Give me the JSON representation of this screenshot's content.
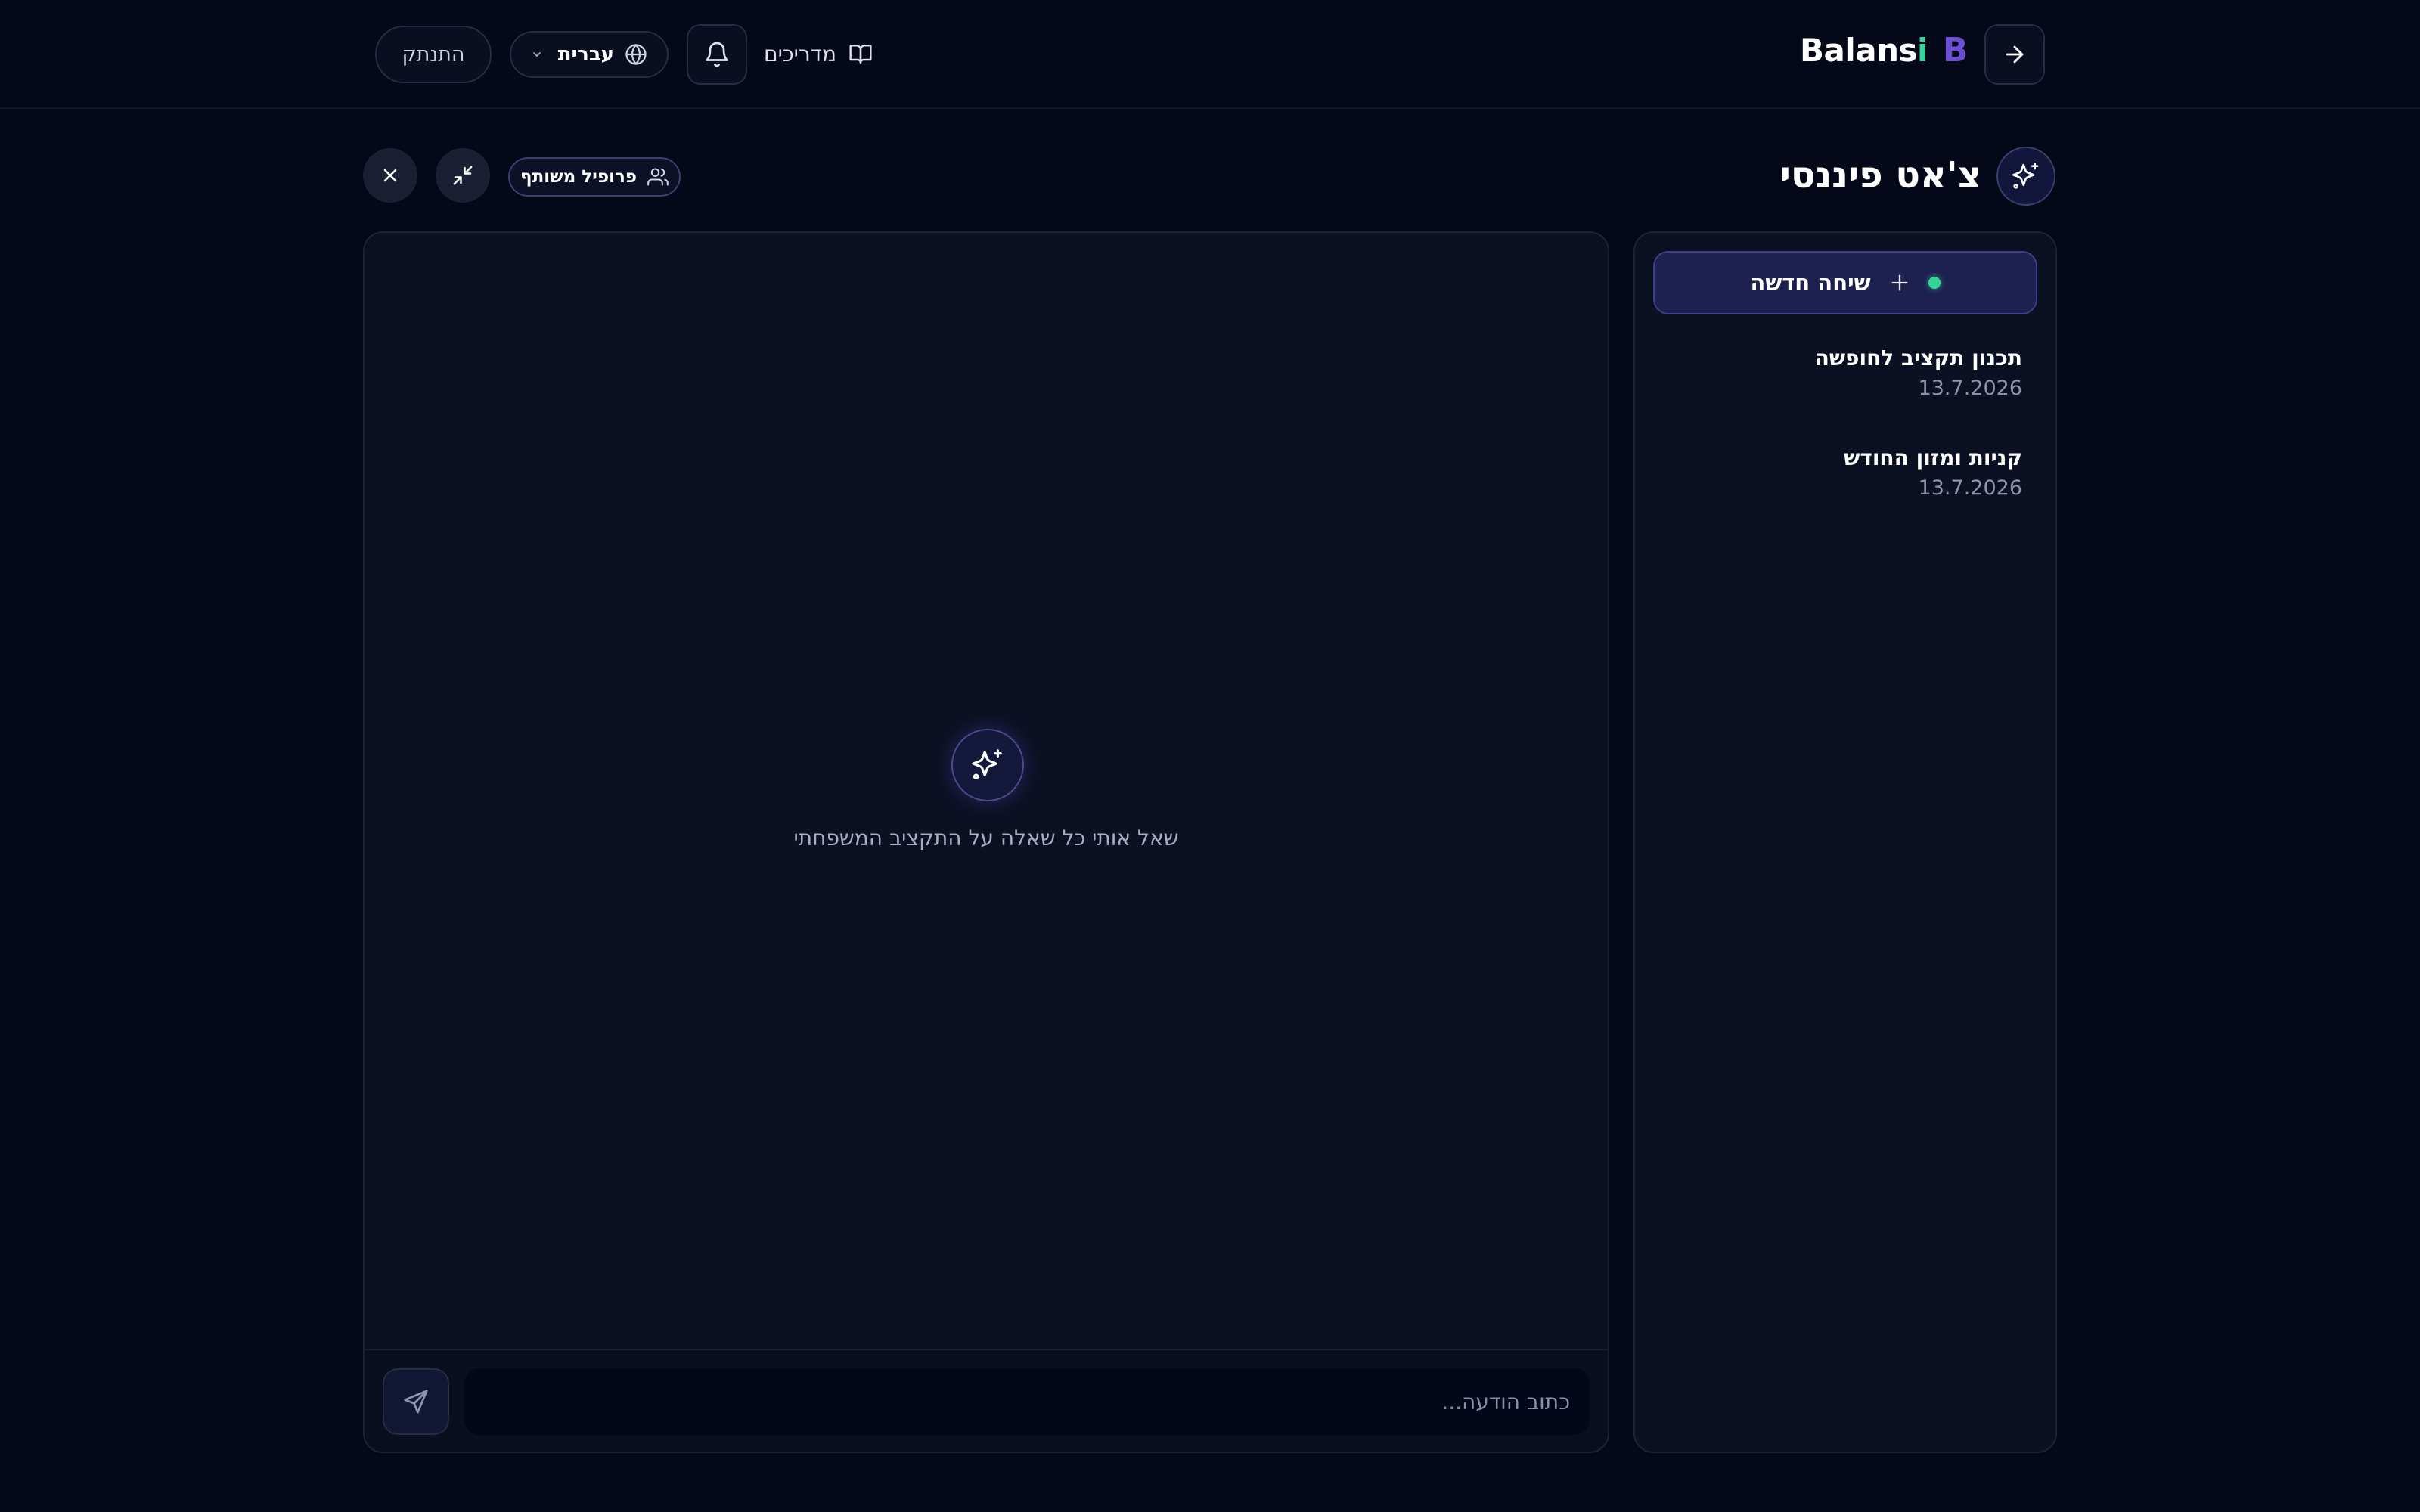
{
  "header": {
    "logout_label": "התנתק",
    "language": "עברית",
    "guides_label": "מדריכים",
    "brand_prefix": "Balans",
    "brand_suffix": "i",
    "brand_logo_letter": "B"
  },
  "chat": {
    "title": "צ'אט פיננסי",
    "shared_profile_label": "פרופיל משותף",
    "empty_prompt": "שאל אותי כל שאלה על התקציב המשפחתי",
    "input_placeholder": "כתוב הודעה..."
  },
  "sidebar": {
    "new_chat_label": "שיחה חדשה",
    "conversations": [
      {
        "title": "תכנון תקציב לחופשה",
        "date": "13.7.2026"
      },
      {
        "title": "קניות ומזון החודש",
        "date": "13.7.2026"
      }
    ]
  },
  "colors": {
    "background": "#050818",
    "panel": "#0b1022",
    "accent_green": "#34d399",
    "accent_purple": "#6d4fd6",
    "new_chat_bg": "#1e2150"
  },
  "icons": {
    "guides": "book-open-icon",
    "notifications": "bell-icon",
    "language": "globe-icon",
    "back": "arrow-right-icon",
    "title": "sparkles-icon",
    "shared": "users-icon",
    "minimize": "minimize-icon",
    "close": "close-icon",
    "send": "send-icon",
    "new_chat": "plus-icon"
  }
}
